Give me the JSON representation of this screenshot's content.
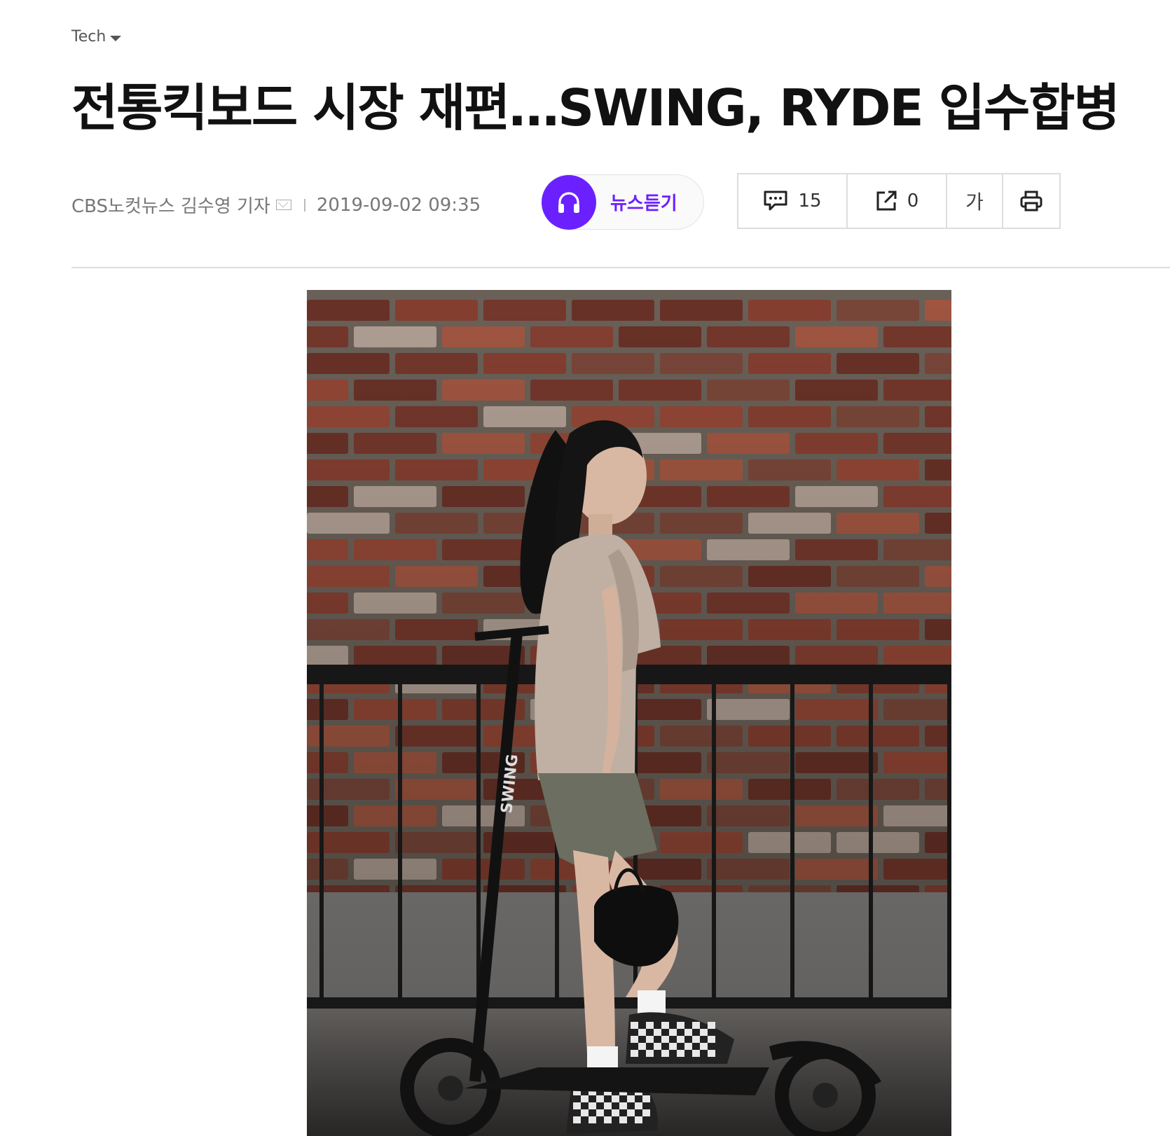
{
  "category": {
    "label": "Tech"
  },
  "article": {
    "title": "전통킥보드 시장 재편…SWING, RYDE 입수합병",
    "source": "CBS노컷뉴스 김수영 기자",
    "datetime": "2019-09-02 09:35"
  },
  "listen": {
    "label": "뉴스듣기"
  },
  "tools": {
    "comment_count": "15",
    "share_count": "0",
    "font_label": "가"
  },
  "photo": {
    "scooter_brand": "SWING"
  },
  "colors": {
    "accent": "#6b21ff",
    "brick": "#8b4233",
    "mortar": "#6f655c"
  }
}
